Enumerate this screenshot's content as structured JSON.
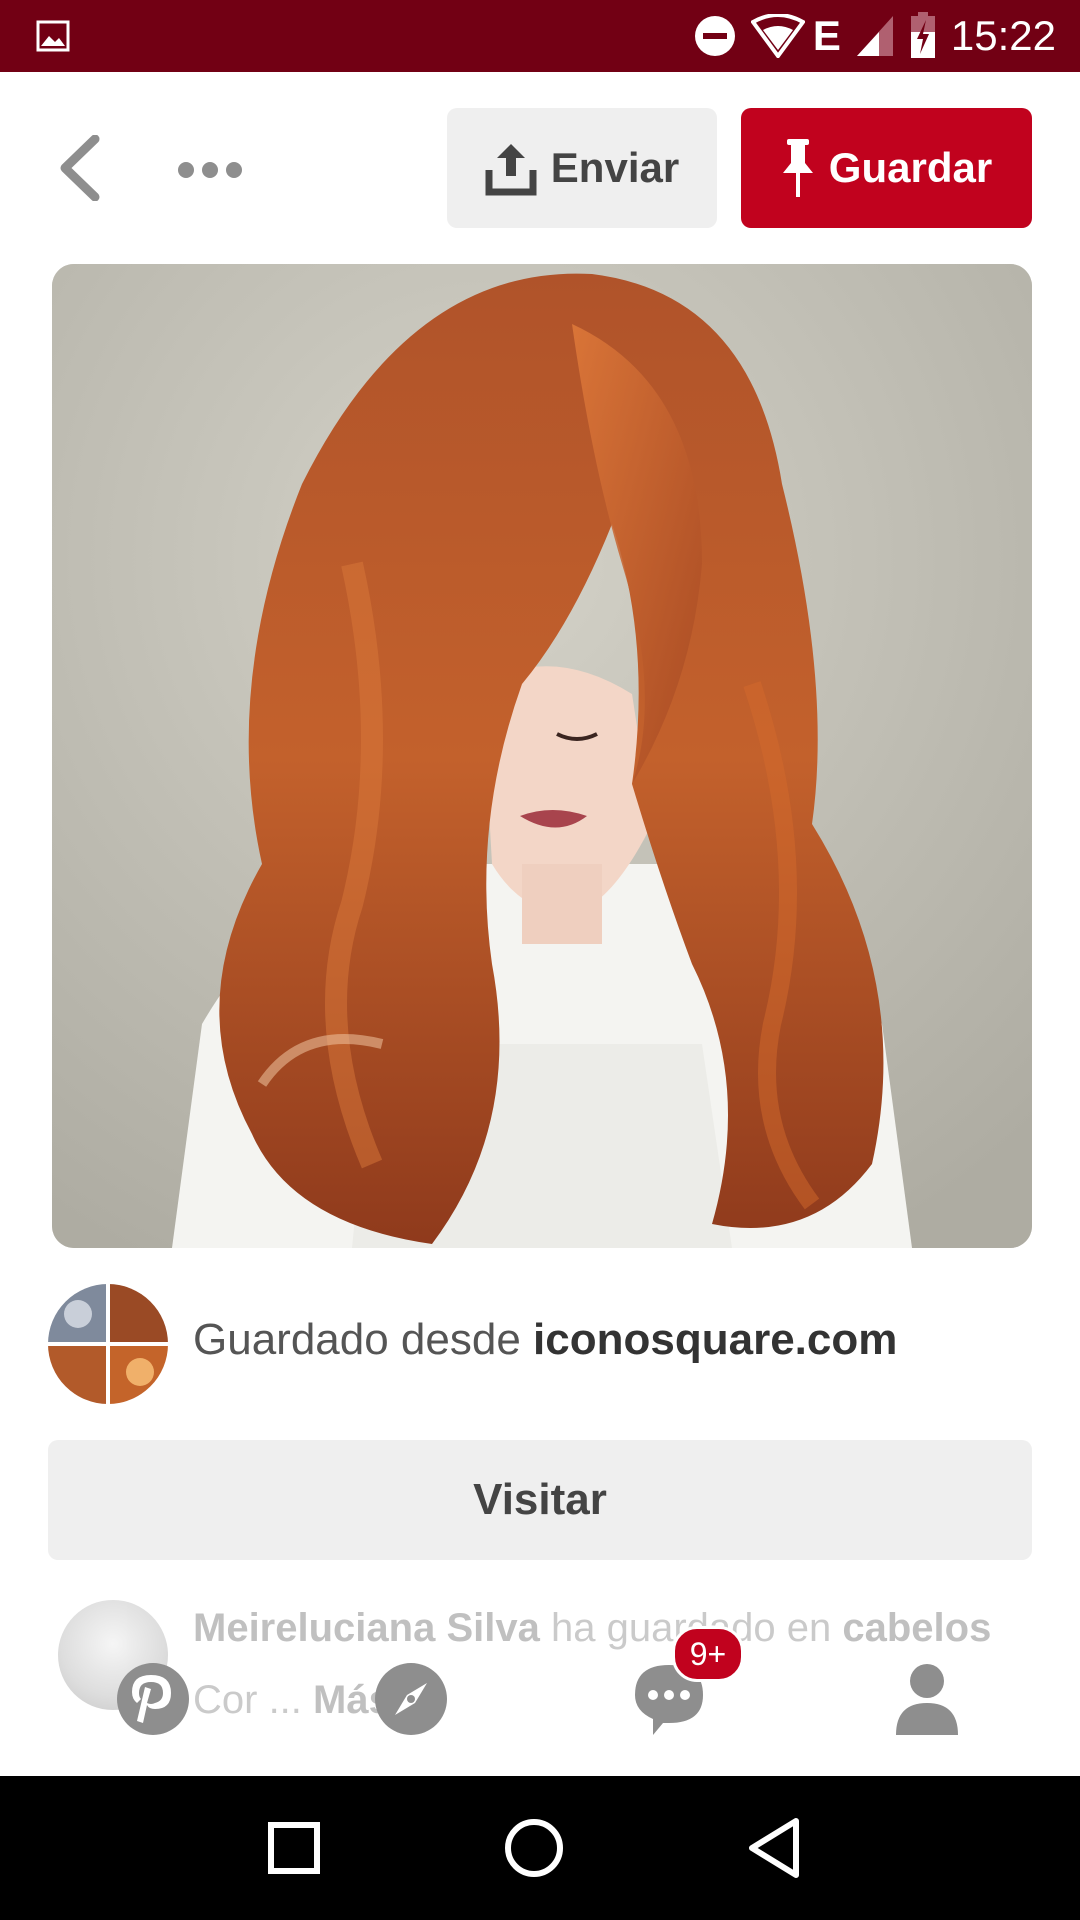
{
  "status_bar": {
    "time": "15:22",
    "network_type": "E",
    "icons": [
      "gallery-icon",
      "do-not-disturb-icon",
      "wifi-icon",
      "signal-icon",
      "battery-charging-icon"
    ]
  },
  "toolbar": {
    "back_icon": "chevron-left-icon",
    "more_icon": "more-horizontal-icon",
    "send_label": "Enviar",
    "save_label": "Guardar"
  },
  "pin": {
    "image_alt": "Woman with long copper-red wavy hair",
    "saved_from_prefix": "Guardado desde",
    "saved_from_domain": "iconosquare.com",
    "visit_label": "Visitar"
  },
  "activity": {
    "user": "Meireluciana Silva",
    "action": "ha guardado en",
    "board": "cabelos",
    "board_cont": "Cor ...",
    "more_label": "Más"
  },
  "bottom_nav": {
    "items": [
      "home-icon",
      "explore-icon",
      "messages-icon",
      "profile-icon"
    ],
    "messages_badge": "9+"
  },
  "system_nav": [
    "recents-icon",
    "home-circle-icon",
    "back-triangle-icon"
  ],
  "colors": {
    "brand_red": "#c1021e",
    "status_bar": "#720014",
    "button_gray": "#efefef"
  }
}
